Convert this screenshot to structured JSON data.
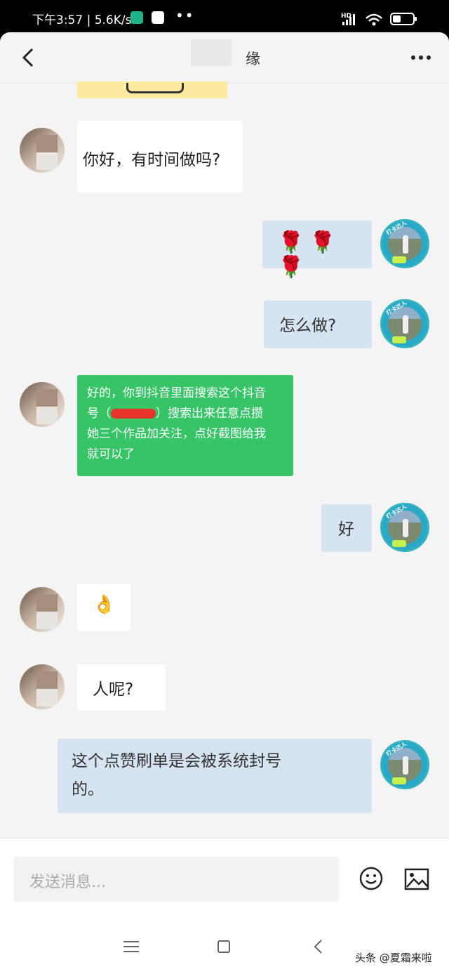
{
  "status": {
    "time": "下午3:57 | 5.6K/s",
    "hd": "HD"
  },
  "header": {
    "title": "缘"
  },
  "messages": {
    "m1": "你好，有时间做吗?",
    "m2": "🌹🌹🌹",
    "m3": "怎么做?",
    "m4_line1": "好的，你到抖音里面搜索这个抖音",
    "m4_line2a": "号（",
    "m4_line2b": "）搜索出来任意点攒",
    "m4_line3": "她三个作品加关注，点好截图给我",
    "m4_line4": "就可以了",
    "m5": "好",
    "m6": "👌",
    "m7": "人呢?",
    "m8_line1": "这个点赞刷单是会被系统封号",
    "m8_line2": "的。"
  },
  "input": {
    "placeholder": "发送消息..."
  },
  "watermark": "头条 @夏霜来啦",
  "colors": {
    "sent_bubble": "#d6e4f2",
    "received_bubble": "#ffffff",
    "green_bubble": "#36c467"
  }
}
